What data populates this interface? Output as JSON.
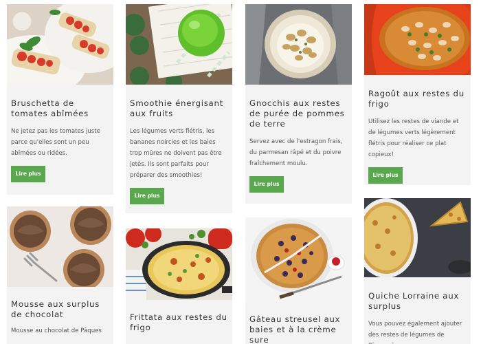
{
  "read_more_label": "Lire plus",
  "recipes": [
    {
      "title": "Bruschetta de tomates abîmées",
      "excerpt": "Ne jetez pas les tomates juste parce qu'elles sont un peu abîmées ou ridées.",
      "image_icon": "bruschetta-photo"
    },
    {
      "title": "Smoothie énergisant aux fruits",
      "excerpt": "Les légumes verts flétris, les bananes noircies et les baies trop mûres ne doivent pas être jetés. Ils sont parfaits pour préparer des smoothies!",
      "image_icon": "green-smoothie-photo"
    },
    {
      "title": "Gnocchis aux restes de purée de pommes de terre",
      "excerpt": "Servez avec de l'estragon frais, du parmesan râpé et du poivre fraîchement moulu.",
      "image_icon": "gnocchi-photo"
    },
    {
      "title": "Ragoût aux restes du frigo",
      "excerpt": "Utilisez les restes de viande et de légumes verts légèrement flétris pour réaliser ce plat copieux!",
      "image_icon": "stew-photo"
    },
    {
      "title": "Mousse aux surplus de chocolat",
      "excerpt": "Mousse au chocolat de Pâques",
      "image_icon": "chocolate-mousse-photo"
    },
    {
      "title": "Frittata aux restes du frigo",
      "excerpt": "",
      "image_icon": "frittata-photo"
    },
    {
      "title": "Gâteau streusel aux baies et à la crème sure",
      "excerpt": "",
      "image_icon": "berry-cake-photo"
    },
    {
      "title": "Quiche Lorraine aux surplus",
      "excerpt": "Vous pouvez également ajouter des restes de légumes de Pâques à",
      "image_icon": "quiche-photo"
    }
  ]
}
